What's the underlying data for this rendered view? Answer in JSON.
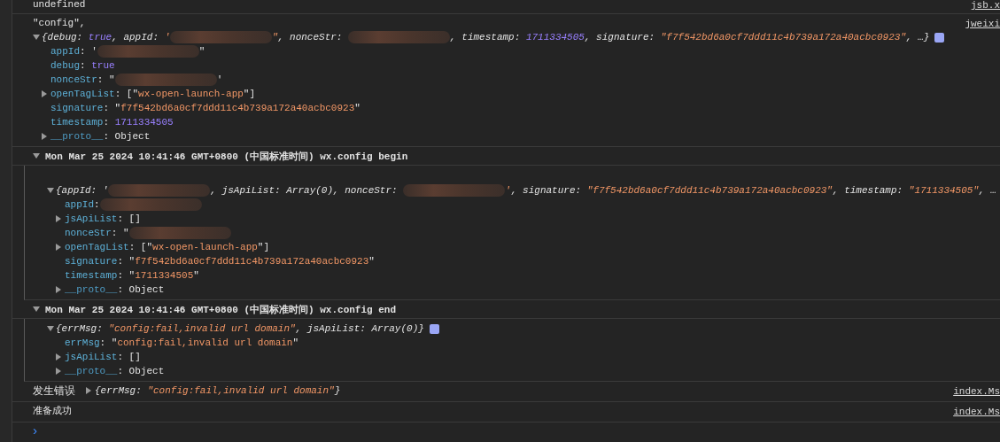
{
  "messages": [
    {
      "kind": "log",
      "source": "jsb.x",
      "lines": [
        {
          "tokens": [
            {
              "kind": "plain",
              "text": "undefined"
            }
          ]
        }
      ]
    },
    {
      "kind": "log",
      "source": "jweixi",
      "lines": [
        {
          "tokens": [
            {
              "kind": "string-plain",
              "text": "\"config\","
            }
          ]
        },
        {
          "expanded": true,
          "italic": true,
          "info": true,
          "tokens": [
            {
              "kind": "plain",
              "text": "{debug: "
            },
            {
              "kind": "bool",
              "text": "true"
            },
            {
              "kind": "plain",
              "text": ", appId: "
            },
            {
              "kind": "string",
              "text": "'"
            },
            {
              "kind": "redacted"
            },
            {
              "kind": "string",
              "text": "\""
            },
            {
              "kind": "plain",
              "text": ", nonceStr: "
            },
            {
              "kind": "redacted"
            },
            {
              "kind": "plain",
              "text": ", timestamp: "
            },
            {
              "kind": "number",
              "text": "1711334505"
            },
            {
              "kind": "plain",
              "text": ", signature: "
            },
            {
              "kind": "string",
              "text": "\"f7f542bd6a0cf7ddd11c4b739a172a40acbc0923\""
            },
            {
              "kind": "plain",
              "text": ", …}"
            }
          ],
          "children": [
            {
              "tokens": [
                {
                  "kind": "key",
                  "text": "appId"
                },
                {
                  "kind": "plain",
                  "text": ": '"
                },
                {
                  "kind": "redacted"
                },
                {
                  "kind": "plain",
                  "text": "\""
                }
              ]
            },
            {
              "tokens": [
                {
                  "kind": "key",
                  "text": "debug"
                },
                {
                  "kind": "plain",
                  "text": ": "
                },
                {
                  "kind": "bool",
                  "text": "true"
                }
              ]
            },
            {
              "tokens": [
                {
                  "kind": "key",
                  "text": "nonceStr"
                },
                {
                  "kind": "plain",
                  "text": ": \""
                },
                {
                  "kind": "redacted"
                },
                {
                  "kind": "plain",
                  "text": "'"
                }
              ]
            },
            {
              "expanded": false,
              "tokens": [
                {
                  "kind": "key",
                  "text": "openTagList"
                },
                {
                  "kind": "plain",
                  "text": ": [\""
                },
                {
                  "kind": "string",
                  "text": "wx-open-launch-app"
                },
                {
                  "kind": "plain",
                  "text": "\"]"
                }
              ]
            },
            {
              "tokens": [
                {
                  "kind": "key",
                  "text": "signature"
                },
                {
                  "kind": "plain",
                  "text": ": \""
                },
                {
                  "kind": "string",
                  "text": "f7f542bd6a0cf7ddd11c4b739a172a40acbc0923"
                },
                {
                  "kind": "plain",
                  "text": "\""
                }
              ]
            },
            {
              "tokens": [
                {
                  "kind": "key",
                  "text": "timestamp"
                },
                {
                  "kind": "plain",
                  "text": ": "
                },
                {
                  "kind": "number",
                  "text": "1711334505"
                }
              ]
            },
            {
              "expanded": false,
              "tokens": [
                {
                  "kind": "proto",
                  "text": "__proto__"
                },
                {
                  "kind": "plain",
                  "text": ": Object"
                }
              ]
            }
          ]
        }
      ]
    },
    {
      "kind": "group",
      "expanded": true,
      "leading_blank": true,
      "title": "Mon Mar 25 2024 10:41:46 GMT+0800 (中国标准时间) wx.config begin",
      "lines": [
        {
          "expanded": true,
          "italic": true,
          "tokens": [
            {
              "kind": "plain",
              "text": "{appId: '"
            },
            {
              "kind": "redacted"
            },
            {
              "kind": "plain",
              "text": ", jsApiList: Array(0), nonceStr: "
            },
            {
              "kind": "redacted"
            },
            {
              "kind": "string",
              "text": "'"
            },
            {
              "kind": "plain",
              "text": ", signature: "
            },
            {
              "kind": "string",
              "text": "\"f7f542bd6a0cf7ddd11c4b739a172a40acbc0923\""
            },
            {
              "kind": "plain",
              "text": ", timestamp: "
            },
            {
              "kind": "string",
              "text": "\"1711334505\""
            },
            {
              "kind": "plain",
              "text": ", …"
            }
          ],
          "children": [
            {
              "tokens": [
                {
                  "kind": "key",
                  "text": "appId"
                },
                {
                  "kind": "plain",
                  "text": ":"
                },
                {
                  "kind": "redacted"
                }
              ]
            },
            {
              "expanded": false,
              "tokens": [
                {
                  "kind": "key",
                  "text": "jsApiList"
                },
                {
                  "kind": "plain",
                  "text": ": []"
                }
              ]
            },
            {
              "tokens": [
                {
                  "kind": "key",
                  "text": "nonceStr"
                },
                {
                  "kind": "plain",
                  "text": ": \""
                },
                {
                  "kind": "redacted"
                }
              ]
            },
            {
              "expanded": false,
              "tokens": [
                {
                  "kind": "key",
                  "text": "openTagList"
                },
                {
                  "kind": "plain",
                  "text": ": [\""
                },
                {
                  "kind": "string",
                  "text": "wx-open-launch-app"
                },
                {
                  "kind": "plain",
                  "text": "\"]"
                }
              ]
            },
            {
              "tokens": [
                {
                  "kind": "key",
                  "text": "signature"
                },
                {
                  "kind": "plain",
                  "text": ": \""
                },
                {
                  "kind": "string",
                  "text": "f7f542bd6a0cf7ddd11c4b739a172a40acbc0923"
                },
                {
                  "kind": "plain",
                  "text": "\""
                }
              ]
            },
            {
              "tokens": [
                {
                  "kind": "key",
                  "text": "timestamp"
                },
                {
                  "kind": "plain",
                  "text": ": \""
                },
                {
                  "kind": "string",
                  "text": "1711334505"
                },
                {
                  "kind": "plain",
                  "text": "\""
                }
              ]
            },
            {
              "expanded": false,
              "tokens": [
                {
                  "kind": "proto",
                  "text": "__proto__"
                },
                {
                  "kind": "plain",
                  "text": ": Object"
                }
              ]
            }
          ]
        }
      ]
    },
    {
      "kind": "group",
      "expanded": true,
      "title": "Mon Mar 25 2024 10:41:46 GMT+0800 (中国标准时间) wx.config end",
      "lines": [
        {
          "expanded": true,
          "italic": true,
          "info": true,
          "tokens": [
            {
              "kind": "plain",
              "text": "{errMsg: "
            },
            {
              "kind": "string",
              "text": "\"config:fail,invalid url domain\""
            },
            {
              "kind": "plain",
              "text": ", jsApiList: Array(0)}"
            }
          ],
          "children": [
            {
              "tokens": [
                {
                  "kind": "key",
                  "text": "errMsg"
                },
                {
                  "kind": "plain",
                  "text": ": \""
                },
                {
                  "kind": "string",
                  "text": "config:fail,invalid url domain"
                },
                {
                  "kind": "plain",
                  "text": "\""
                }
              ]
            },
            {
              "expanded": false,
              "tokens": [
                {
                  "kind": "key",
                  "text": "jsApiList"
                },
                {
                  "kind": "plain",
                  "text": ": []"
                }
              ]
            },
            {
              "expanded": false,
              "tokens": [
                {
                  "kind": "proto",
                  "text": "__proto__"
                },
                {
                  "kind": "plain",
                  "text": ": Object"
                }
              ]
            }
          ]
        }
      ]
    },
    {
      "kind": "log",
      "source": "index.Ms",
      "lines": [
        {
          "prefix": "发生错误",
          "expanded": false,
          "italic": true,
          "tokens": [
            {
              "kind": "plain",
              "text": "{errMsg: "
            },
            {
              "kind": "string",
              "text": "\"config:fail,invalid url domain\""
            },
            {
              "kind": "plain",
              "text": "}"
            }
          ]
        }
      ]
    },
    {
      "kind": "log",
      "source": "index.Ms",
      "lines": [
        {
          "tokens": [
            {
              "kind": "plain",
              "text": "准备成功"
            }
          ]
        }
      ]
    }
  ],
  "prompt": {
    "symbol": "›"
  }
}
